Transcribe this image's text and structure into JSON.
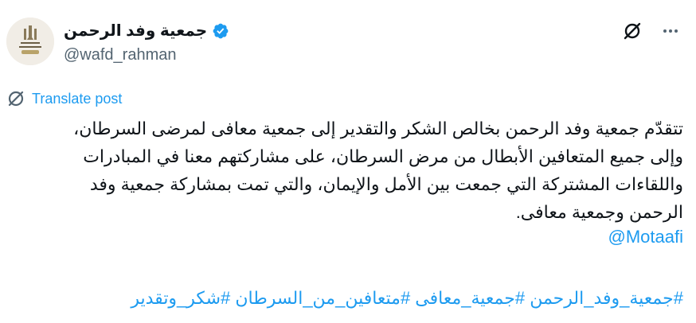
{
  "author": {
    "display_name": "جمعية وفد الرحمن",
    "handle": "@wafd_rahman",
    "avatar_icon": "organization-logo",
    "verified_icon": "verified-badge-icon",
    "verified_color": "#1d9bf0"
  },
  "header_actions": {
    "grok_icon": "grok-icon",
    "more_icon": "more-options-icon"
  },
  "translate": {
    "icon": "translate-icon",
    "label": "Translate post"
  },
  "post": {
    "lines": [
      "تتقدّم جمعية وفد الرحمن بخالص الشكر والتقدير إلى جمعية معافى لمرضى السرطان،",
      "وإلى جميع المتعافين الأبطال من مرض السرطان، على مشاركتهم معنا في المبادرات",
      "واللقاءات المشتركة التي جمعت بين الأمل والإيمان، والتي تمت بمشاركة جمعية وفد",
      "الرحمن وجمعية معافى."
    ],
    "mention": "@Motaafi",
    "hashtags": "#جمعية_وفد_الرحمن #جمعية_معافى #متعافين_من_السرطان #شكر_وتقدير"
  },
  "colors": {
    "link": "#1d9bf0",
    "text": "#0f1419",
    "secondary": "#536471"
  }
}
